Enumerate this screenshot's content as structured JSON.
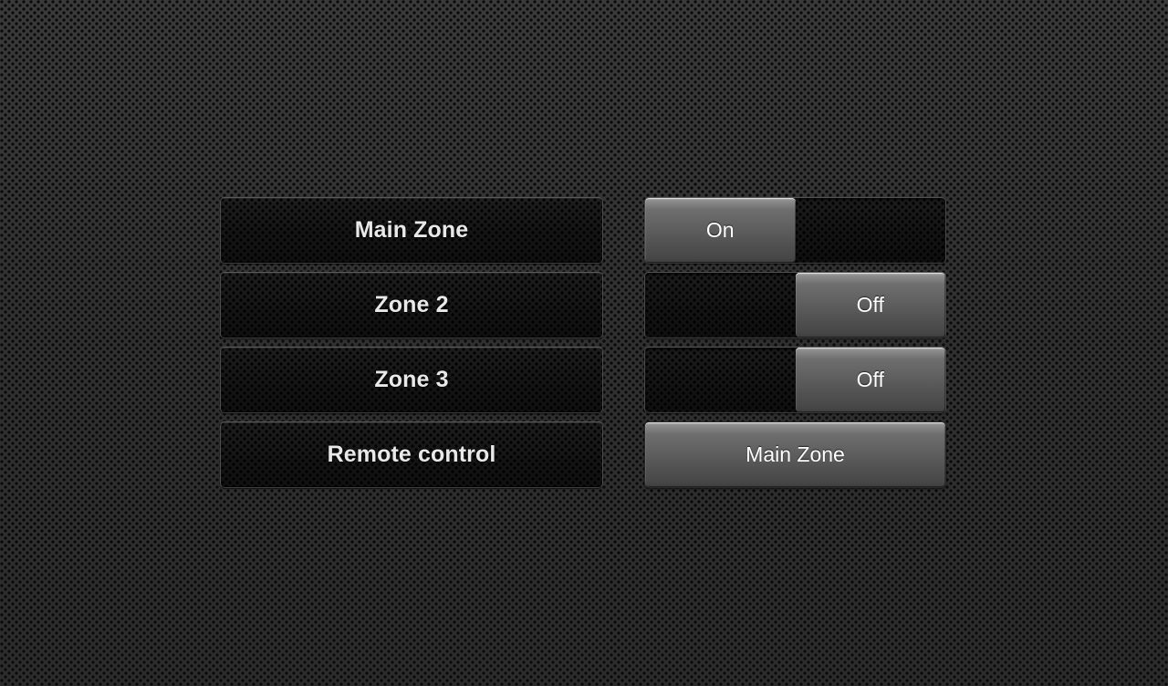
{
  "theme": {
    "background_color": "#343434",
    "button_dark_color": "#181818",
    "button_light_color": "#5d5d5d",
    "text_primary_color": "#e9e9e9",
    "text_on_light_color": "#ffffff"
  },
  "rows": [
    {
      "zone_label": "Main Zone",
      "control_type": "toggle",
      "state_label": "On",
      "thumb_position": "left"
    },
    {
      "zone_label": "Zone 2",
      "control_type": "toggle",
      "state_label": "Off",
      "thumb_position": "right"
    },
    {
      "zone_label": "Zone 3",
      "control_type": "toggle",
      "state_label": "Off",
      "thumb_position": "right"
    },
    {
      "zone_label": "Remote control",
      "control_type": "button",
      "state_label": "Main Zone",
      "thumb_position": "none"
    }
  ]
}
